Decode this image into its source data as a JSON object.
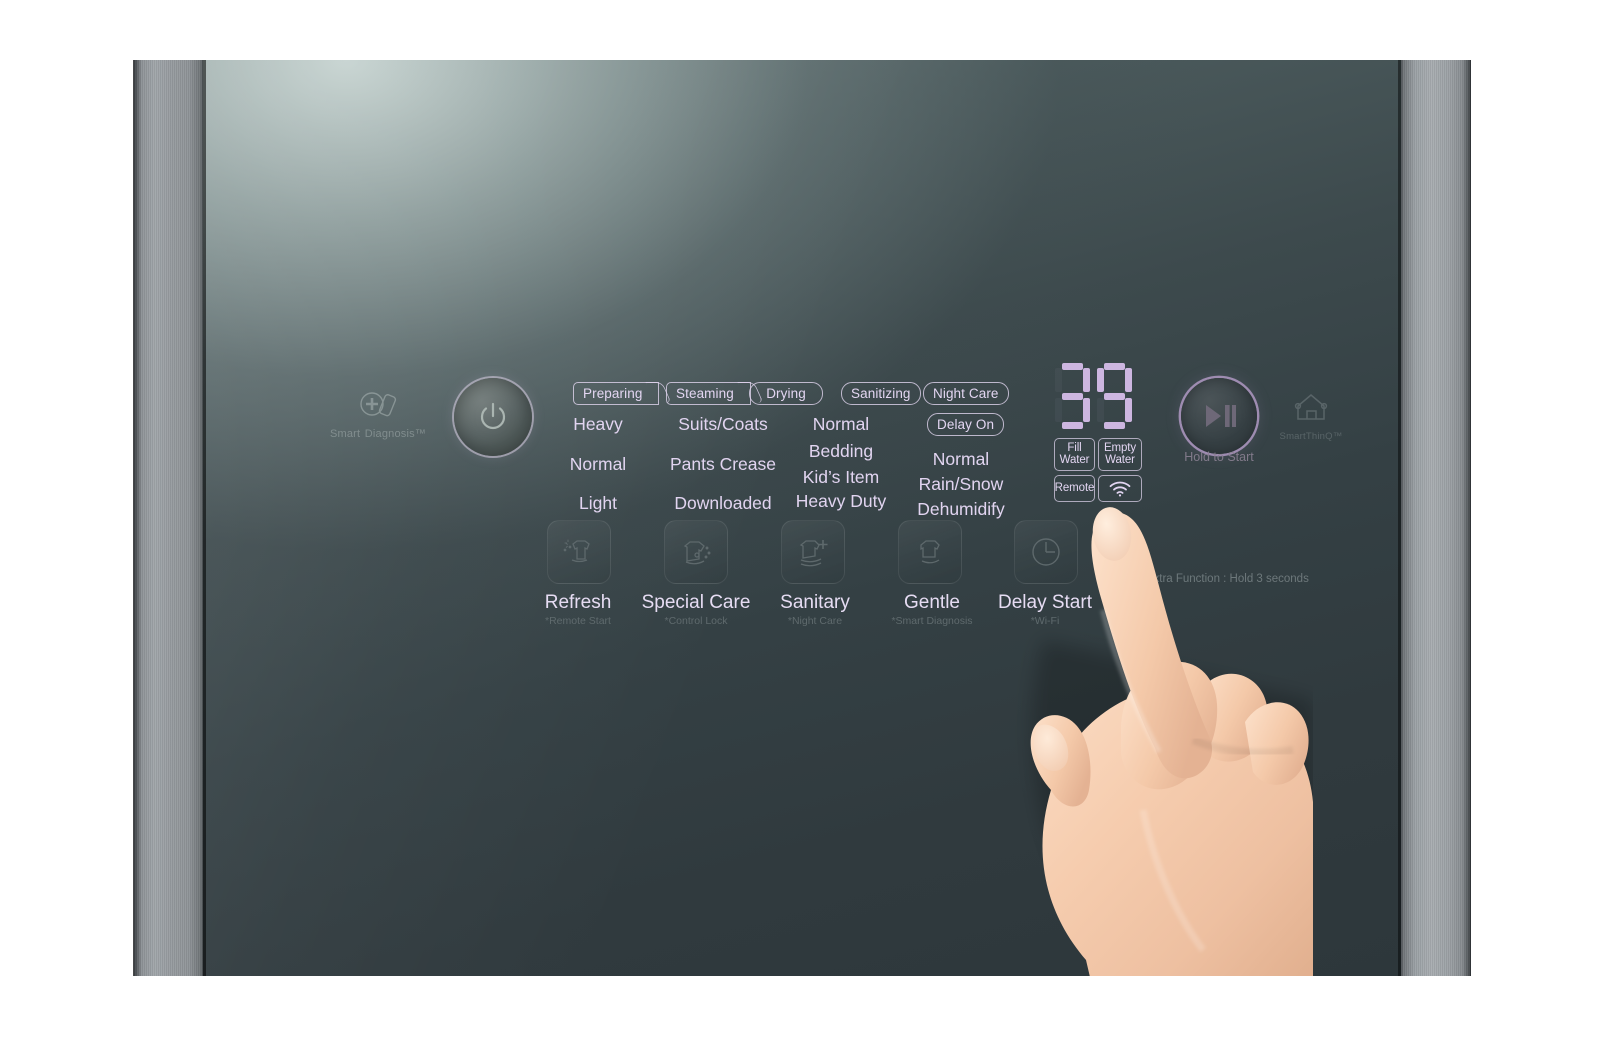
{
  "device": {
    "type": "clothing-care-appliance-control-panel",
    "brand_marks": {
      "smart_diagnosis": {
        "line1": "Smart",
        "line2": "Diagnosis™",
        "icon": "smart-diagnosis-icon"
      },
      "smart_thinq": {
        "label": "SmartThinQ™",
        "icon": "home-wifi-icon"
      }
    }
  },
  "power_button": {
    "name": "Power",
    "icon": "power-icon"
  },
  "status_pills": [
    {
      "id": "preparing",
      "label": "Preparing",
      "shape": "chevron",
      "active": false
    },
    {
      "id": "steaming",
      "label": "Steaming",
      "shape": "chevron",
      "active": false
    },
    {
      "id": "drying",
      "label": "Drying",
      "shape": "rounded",
      "active": false
    },
    {
      "id": "sanitizing",
      "label": "Sanitizing",
      "shape": "rounded",
      "active": false
    },
    {
      "id": "night-care",
      "label": "Night Care",
      "shape": "rounded",
      "active": false
    },
    {
      "id": "delay-on",
      "label": "Delay On",
      "shape": "rounded",
      "active": false
    }
  ],
  "course_columns": [
    {
      "id": "refresh-courses",
      "items": [
        "Heavy",
        "Normal",
        "Light"
      ]
    },
    {
      "id": "special-care-courses",
      "items": [
        "Suits/Coats",
        "Pants Crease",
        "Downloaded"
      ]
    },
    {
      "id": "sanitary-courses",
      "items": [
        "Normal",
        "Bedding",
        "Kid’s Item",
        "Heavy Duty"
      ]
    },
    {
      "id": "gentle-dry-courses",
      "items": [
        "Normal",
        "Rain/Snow",
        "Dehumidify"
      ]
    }
  ],
  "display": {
    "name": "time-display",
    "value": "39",
    "digits": [
      "3",
      "9"
    ],
    "color": "#cdb6e0",
    "indicators": [
      {
        "id": "fill-water",
        "line1": "Fill",
        "line2": "Water",
        "active": false
      },
      {
        "id": "empty-water",
        "line1": "Empty",
        "line2": "Water",
        "active": false
      },
      {
        "id": "remote",
        "line1": "Remote",
        "line2": "",
        "active": false
      },
      {
        "id": "wifi",
        "line1": "",
        "line2": "",
        "icon": "wifi-icon",
        "active": false
      }
    ]
  },
  "start_button": {
    "label": "Hold to Start",
    "icon": "play-pause-icon"
  },
  "function_buttons": [
    {
      "id": "refresh",
      "label": "Refresh",
      "sub": "*Remote Start",
      "icon": "shirt-sparkle-icon"
    },
    {
      "id": "special-care",
      "label": "Special Care",
      "sub": "*Control Lock",
      "icon": "shirt-care-icon"
    },
    {
      "id": "sanitary",
      "label": "Sanitary",
      "sub": "*Night Care",
      "icon": "shirt-plus-icon"
    },
    {
      "id": "gentle-dry",
      "label": "Gentle",
      "sub": "*Smart Diagnosis",
      "icon": "shirt-dry-icon",
      "pressed": true
    },
    {
      "id": "delay-start",
      "label": "Delay Start",
      "sub": "*Wi-Fi",
      "icon": "clock-icon"
    }
  ],
  "footnote": {
    "text": "✻ Extra Function : Hold 3 seconds"
  },
  "hand": {
    "present": true,
    "gesture": "index-finger-pressing",
    "target": "gentle-dry"
  },
  "colors": {
    "accent_lilac": "#e1d4f0",
    "display_lilac": "#cdb6e0",
    "panel_dark": "#323c40",
    "bezel_steel": "#9ba0a4",
    "dim_text": "#6f7b7e"
  }
}
